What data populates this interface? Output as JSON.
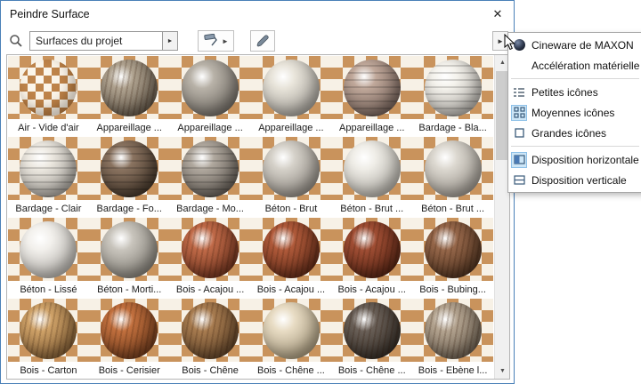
{
  "window": {
    "title": "Peindre Surface"
  },
  "icons": {
    "close": "✕",
    "combo_arrow": "►",
    "flyout_arrow": "►",
    "menu_open_arrow": "►",
    "scroll_up": "▲",
    "scroll_down": "▼"
  },
  "toolbar": {
    "search_value": "Surfaces du projet"
  },
  "grid": {
    "tiles": [
      {
        "label": "Air - Vide d'air",
        "hi": "#f2e6d0",
        "lo": "#b5793e",
        "tex": "checker"
      },
      {
        "label": "Appareillage ...",
        "hi": "#b0a390",
        "lo": "#463c30",
        "tex": "wood"
      },
      {
        "label": "Appareillage ...",
        "hi": "#b8b2a8",
        "lo": "#55504a",
        "tex": "plain"
      },
      {
        "label": "Appareillage ...",
        "hi": "#e8e4da",
        "lo": "#84807a",
        "tex": "plain"
      },
      {
        "label": "Appareillage ...",
        "hi": "#c0a89a",
        "lo": "#564640",
        "tex": "stripes"
      },
      {
        "label": "Bardage - Bla...",
        "hi": "#f4f2ec",
        "lo": "#94908a",
        "tex": "stripes"
      },
      {
        "label": "Bardage - Clair",
        "hi": "#ece8e0",
        "lo": "#86827c",
        "tex": "stripes"
      },
      {
        "label": "Bardage - Fo...",
        "hi": "#8a7360",
        "lo": "#2a2016",
        "tex": "stripes"
      },
      {
        "label": "Bardage - Mo...",
        "hi": "#b0a89e",
        "lo": "#46403a",
        "tex": "stripes"
      },
      {
        "label": "Béton - Brut",
        "hi": "#d5d1c9",
        "lo": "#716b64",
        "tex": "plain"
      },
      {
        "label": "Béton - Brut ...",
        "hi": "#efede7",
        "lo": "#928e86",
        "tex": "plain"
      },
      {
        "label": "Béton - Brut ...",
        "hi": "#dcd8d0",
        "lo": "#7c766e",
        "tex": "plain"
      },
      {
        "label": "Béton - Lissé",
        "hi": "#f2f0ec",
        "lo": "#96928c",
        "tex": "plain"
      },
      {
        "label": "Béton - Morti...",
        "hi": "#c8c4bc",
        "lo": "#66625a",
        "tex": "plain"
      },
      {
        "label": "Bois - Acajou ...",
        "hi": "#c06a48",
        "lo": "#552212",
        "tex": "wood"
      },
      {
        "label": "Bois - Acajou ...",
        "hi": "#b05a3a",
        "lo": "#461c0e",
        "tex": "wood"
      },
      {
        "label": "Bois - Acajou ...",
        "hi": "#a04e34",
        "lo": "#3c160a",
        "tex": "wood"
      },
      {
        "label": "Bois - Bubing...",
        "hi": "#96674a",
        "lo": "#362112",
        "tex": "wood"
      },
      {
        "label": "Bois - Carton",
        "hi": "#cfa268",
        "lo": "#644524",
        "tex": "wood"
      },
      {
        "label": "Bois - Cerisier",
        "hi": "#c2703e",
        "lo": "#542a12",
        "tex": "wood"
      },
      {
        "label": "Bois - Chêne",
        "hi": "#a87c50",
        "lo": "#46301c",
        "tex": "wood"
      },
      {
        "label": "Bois - Chêne ...",
        "hi": "#e8dcc4",
        "lo": "#86785c",
        "tex": "plain"
      },
      {
        "label": "Bois - Chêne ...",
        "hi": "#6a6058",
        "lo": "#201a14",
        "tex": "wood"
      },
      {
        "label": "Bois - Ebène l...",
        "hi": "#b4a490",
        "lo": "#50463a",
        "tex": "wood"
      }
    ]
  },
  "menu": {
    "items": [
      {
        "label": "Cineware de MAXON",
        "selected": false
      },
      {
        "label": "Accélération matérielle",
        "selected": false
      },
      {
        "label": "Petites icônes",
        "selected": false
      },
      {
        "label": "Moyennes icônes",
        "selected": true
      },
      {
        "label": "Grandes icônes",
        "selected": false
      },
      {
        "label": "Disposition horizontale",
        "selected": true
      },
      {
        "label": "Disposition verticale",
        "selected": false
      }
    ]
  }
}
